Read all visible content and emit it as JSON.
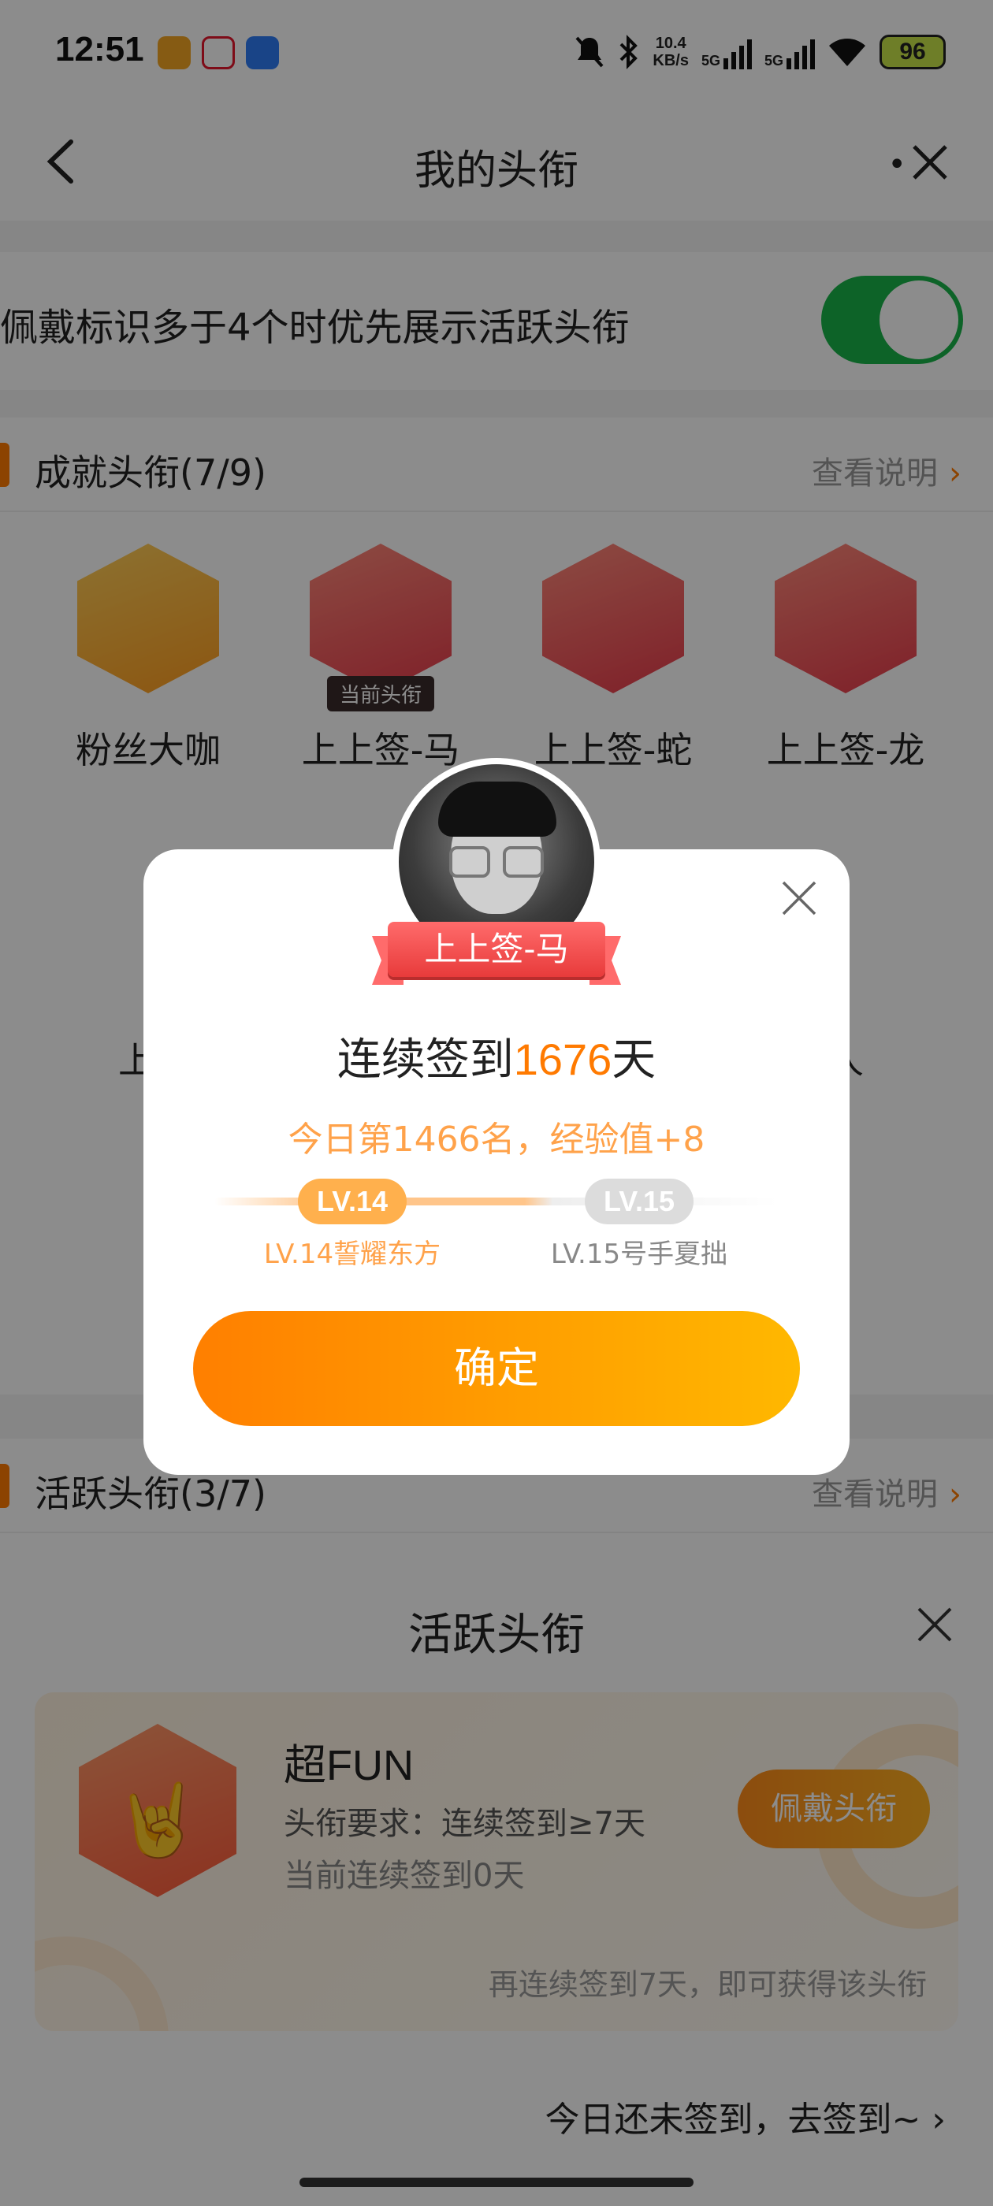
{
  "status_bar": {
    "time": "12:51",
    "net_speed_value": "10.4",
    "net_speed_unit": "KB/s",
    "sig1": "5G",
    "sig2": "5G",
    "battery": "96"
  },
  "header": {
    "title": "我的头衔",
    "more_glyph": "•",
    "icons": [
      "back-arrow-icon",
      "more-icon",
      "close-icon"
    ]
  },
  "settings": {
    "toggle_label": "佩戴标识多于4个时优先展示活跃头衔",
    "toggle_on": true,
    "toggle_color": "#19b54a"
  },
  "achievements": {
    "title": "成就头衔(7/9)",
    "link": "查看说明",
    "chevron": "›",
    "current_tag": "当前头衔",
    "badges": [
      {
        "name": "粉丝大咖",
        "icon": "crown-icon",
        "color": "#ffb13b"
      },
      {
        "name": "上上签-马",
        "icon": "horse-icon",
        "color": "#f2545b",
        "current": true
      },
      {
        "name": "上上签-蛇",
        "icon": "snake-icon",
        "color": "#f2545b"
      },
      {
        "name": "上上签-龙",
        "icon": "dragon-icon",
        "color": "#f2545b"
      }
    ],
    "partial_left": "上",
    "partial_right": "人"
  },
  "active": {
    "title": "活跃头衔(3/7)",
    "link": "查看说明",
    "chevron": "›"
  },
  "sheet": {
    "title": "活跃头衔",
    "card": {
      "name": "超FUN",
      "icon": "rock-hand-icon",
      "hand_glyph": "🤘",
      "requirement": "头衔要求：连续签到≥7天",
      "current": "当前连续签到0天",
      "wear_button": "佩戴头衔",
      "hint": "再连续签到7天，即可获得该头衔"
    },
    "footer": "今日还未签到，去签到~ ›"
  },
  "modal": {
    "ribbon": "上上签-马",
    "streak_prefix": "连续签到",
    "streak_days": "1676",
    "streak_suffix": "天",
    "rank": "今日第1466名，经验值+8",
    "level_current": "LV.14",
    "level_next": "LV.15",
    "level_current_caption": "LV.14誓耀东方",
    "level_next_caption": "LV.15号手夏拙",
    "confirm": "确定",
    "accent": "#ff7a00"
  }
}
